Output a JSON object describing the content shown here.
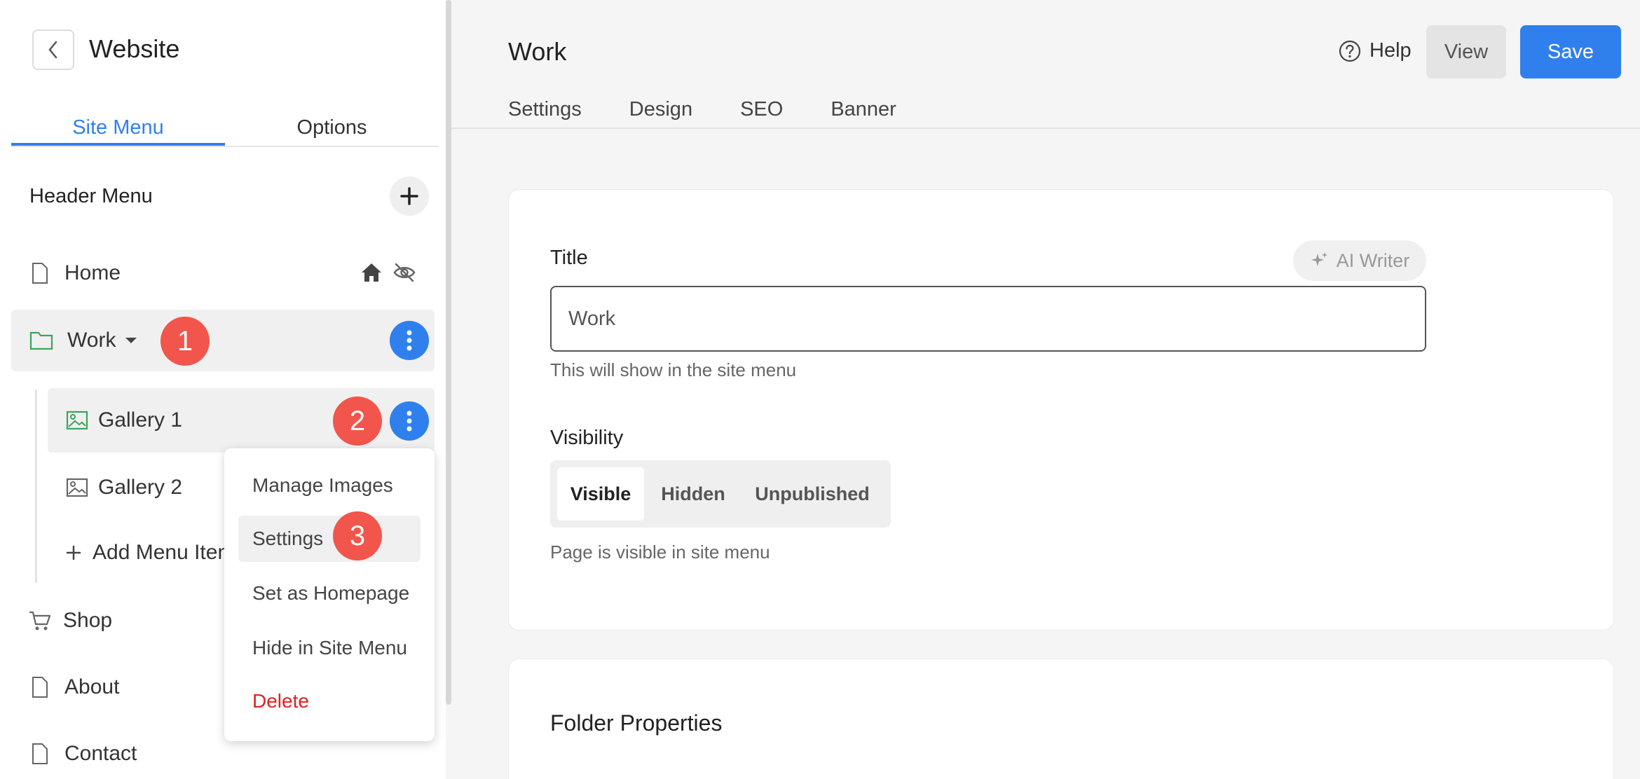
{
  "sidebar": {
    "title": "Website",
    "tabs": [
      "Site Menu",
      "Options"
    ],
    "section_label": "Header Menu",
    "items": {
      "home": "Home",
      "work": "Work",
      "gallery1": "Gallery 1",
      "gallery2": "Gallery 2",
      "add_item": "Add Menu Item",
      "shop": "Shop",
      "about": "About",
      "contact": "Contact"
    },
    "badges": [
      "1",
      "2",
      "3"
    ]
  },
  "context_menu": {
    "items": [
      "Manage Images",
      "Settings",
      "Set as Homepage",
      "Hide in Site Menu",
      "Delete"
    ],
    "highlighted": "Settings",
    "delete_color": "#e02020"
  },
  "header": {
    "title": "Work",
    "help_label": "Help",
    "view_label": "View",
    "save_label": "Save"
  },
  "main_tabs": [
    "Settings",
    "Design",
    "SEO",
    "Banner"
  ],
  "form": {
    "title_label": "Title",
    "ai_writer_label": "AI Writer",
    "title_value": "Work",
    "title_hint": "This will show in the site menu",
    "visibility_label": "Visibility",
    "visibility_options": [
      "Visible",
      "Hidden",
      "Unpublished"
    ],
    "visibility_selected": "Visible",
    "visibility_hint": "Page is visible in site menu",
    "folder_properties_label": "Folder Properties"
  },
  "colors": {
    "accent": "#2f80ed",
    "badge": "#f2554b",
    "folder_icon": "#3aa657"
  }
}
